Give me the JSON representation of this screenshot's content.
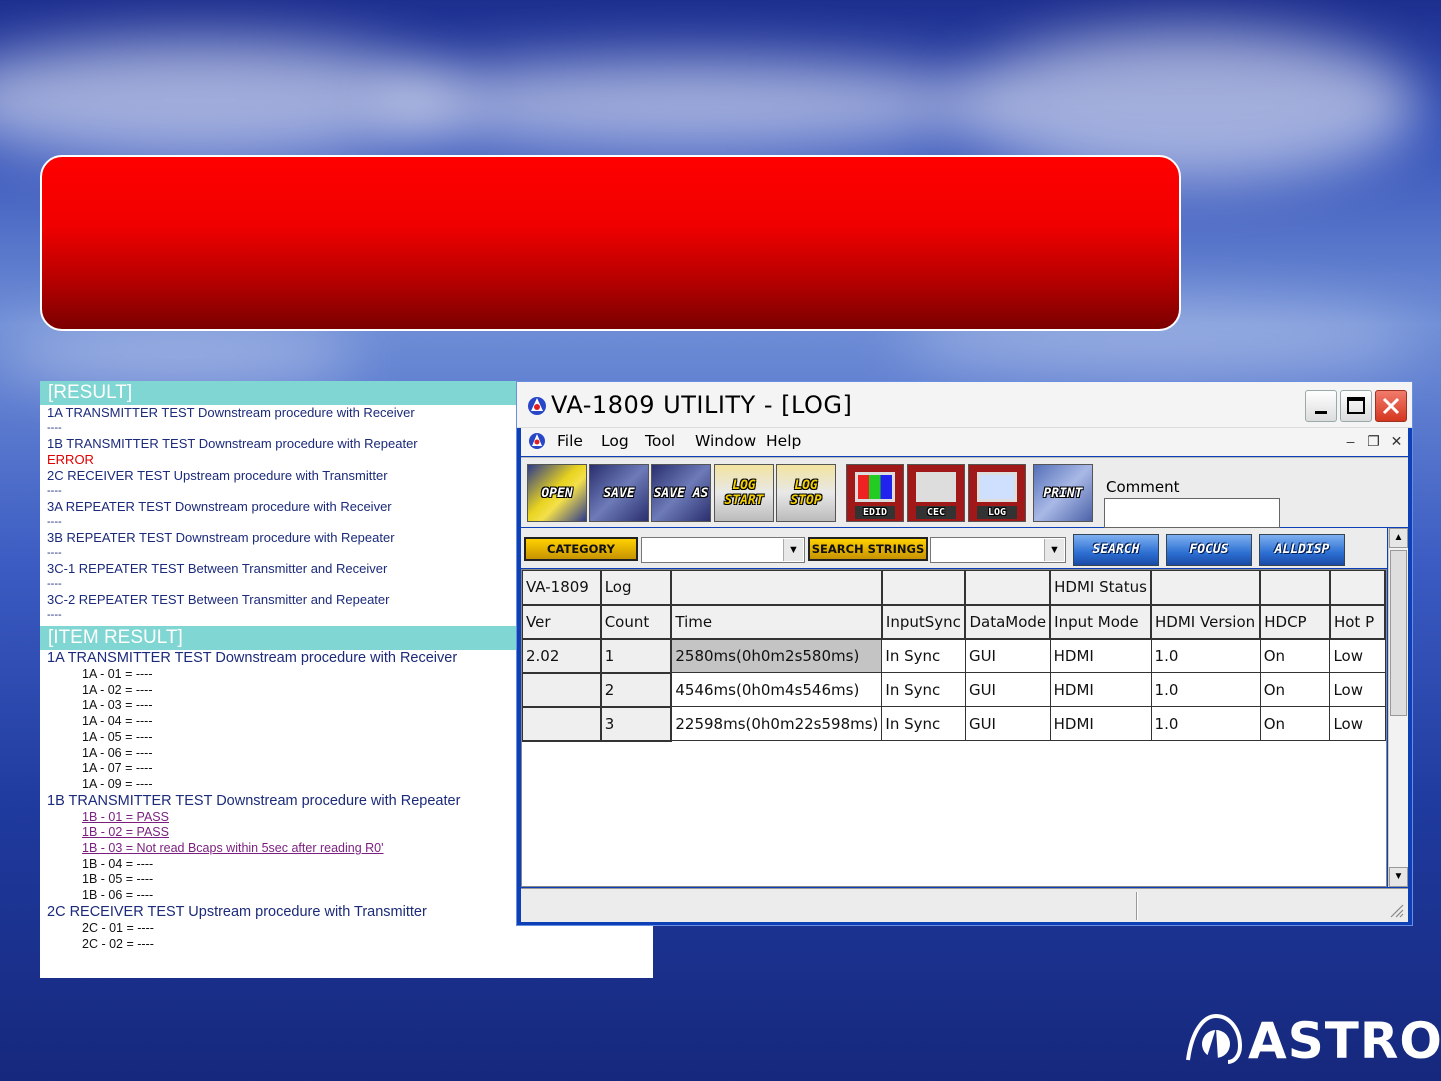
{
  "results": {
    "result_header": "[RESULT]",
    "summary": [
      {
        "test": "1A TRANSMITTER TEST Downstream procedure with Receiver",
        "status": "----",
        "error": false
      },
      {
        "test": "1B TRANSMITTER TEST Downstream procedure with Repeater",
        "status": "ERROR",
        "error": true
      },
      {
        "test": "2C RECEIVER TEST Upstream procedure with Transmitter",
        "status": "----",
        "error": false
      },
      {
        "test": "3A REPEATER TEST Downstream procedure with Receiver",
        "status": "----",
        "error": false
      },
      {
        "test": "3B REPEATER TEST Downstream procedure with Repeater",
        "status": "----",
        "error": false
      },
      {
        "test": "3C-1 REPEATER TEST Between Transmitter and Receiver",
        "status": "----",
        "error": false
      },
      {
        "test": "3C-2 REPEATER TEST Between Transmitter and Repeater",
        "status": "----",
        "error": false
      }
    ],
    "item_result_header": "[ITEM RESULT]",
    "items": [
      {
        "title": "1A TRANSMITTER TEST Downstream procedure with Receiver",
        "rows": [
          {
            "text": "1A - 01 = ----",
            "link": false
          },
          {
            "text": "1A - 02 = ----",
            "link": false
          },
          {
            "text": "1A - 03 = ----",
            "link": false
          },
          {
            "text": "1A - 04 = ----",
            "link": false
          },
          {
            "text": "1A - 05 = ----",
            "link": false
          },
          {
            "text": "1A - 06 = ----",
            "link": false
          },
          {
            "text": "1A - 07 = ----",
            "link": false
          },
          {
            "text": "1A - 09 = ----",
            "link": false
          }
        ]
      },
      {
        "title": "1B TRANSMITTER TEST Downstream procedure with Repeater",
        "rows": [
          {
            "text": "1B - 01 = PASS",
            "link": true
          },
          {
            "text": "1B - 02 = PASS",
            "link": true
          },
          {
            "text": "1B - 03 = Not read Bcaps within 5sec after reading R0'",
            "link": true
          },
          {
            "text": "1B - 04 = ----",
            "link": false
          },
          {
            "text": "1B - 05 = ----",
            "link": false
          },
          {
            "text": "1B - 06 = ----",
            "link": false
          }
        ]
      },
      {
        "title": "2C RECEIVER TEST Upstream procedure with Transmitter",
        "rows": [
          {
            "text": "2C - 01 = ----",
            "link": false
          },
          {
            "text": "2C - 02 = ----",
            "link": false
          }
        ]
      }
    ]
  },
  "window": {
    "title": "VA-1809 UTILITY - [LOG]",
    "menu": [
      "File",
      "Log",
      "Tool",
      "Window",
      "Help"
    ],
    "toolbar": {
      "open": "OPEN",
      "save": "SAVE",
      "save_as": "SAVE AS",
      "log_start": "LOG START",
      "log_stop": "LOG STOP",
      "edid": "EDID",
      "cec": "CEC",
      "log": "LOG",
      "print": "PRINT",
      "comment_label": "Comment",
      "comment_value": ""
    },
    "filter": {
      "category_label": "CATEGORY",
      "category_value": "",
      "search_strings_label": "SEARCH STRINGS",
      "search_value": "",
      "search_button": "SEARCH",
      "focus_button": "FOCUS",
      "alldisp_button": "ALLDISP"
    },
    "grid": {
      "header1": [
        "VA-1809",
        "Log",
        "",
        "",
        "",
        "HDMI Status",
        "",
        "",
        ""
      ],
      "header2": [
        "Ver",
        "Count",
        "Time",
        "InputSync",
        "DataMode",
        "Input Mode",
        "HDMI Version",
        "HDCP",
        "Hot P"
      ],
      "rows": [
        [
          "2.02",
          "1",
          "2580ms(0h0m2s580ms)",
          "In Sync",
          "GUI",
          "HDMI",
          "1.0",
          "On",
          "Low"
        ],
        [
          "",
          "2",
          "4546ms(0h0m4s546ms)",
          "In Sync",
          "GUI",
          "HDMI",
          "1.0",
          "On",
          "Low"
        ],
        [
          "",
          "3",
          "22598ms(0h0m22s598ms)",
          "In Sync",
          "GUI",
          "HDMI",
          "1.0",
          "On",
          "Low"
        ]
      ]
    }
  },
  "logo": {
    "text": "ASTRO"
  },
  "colors": {
    "banner": "#ff0000",
    "result_header": "#7fd6d2",
    "error": "#e00000",
    "link": "#7a1f7f"
  }
}
